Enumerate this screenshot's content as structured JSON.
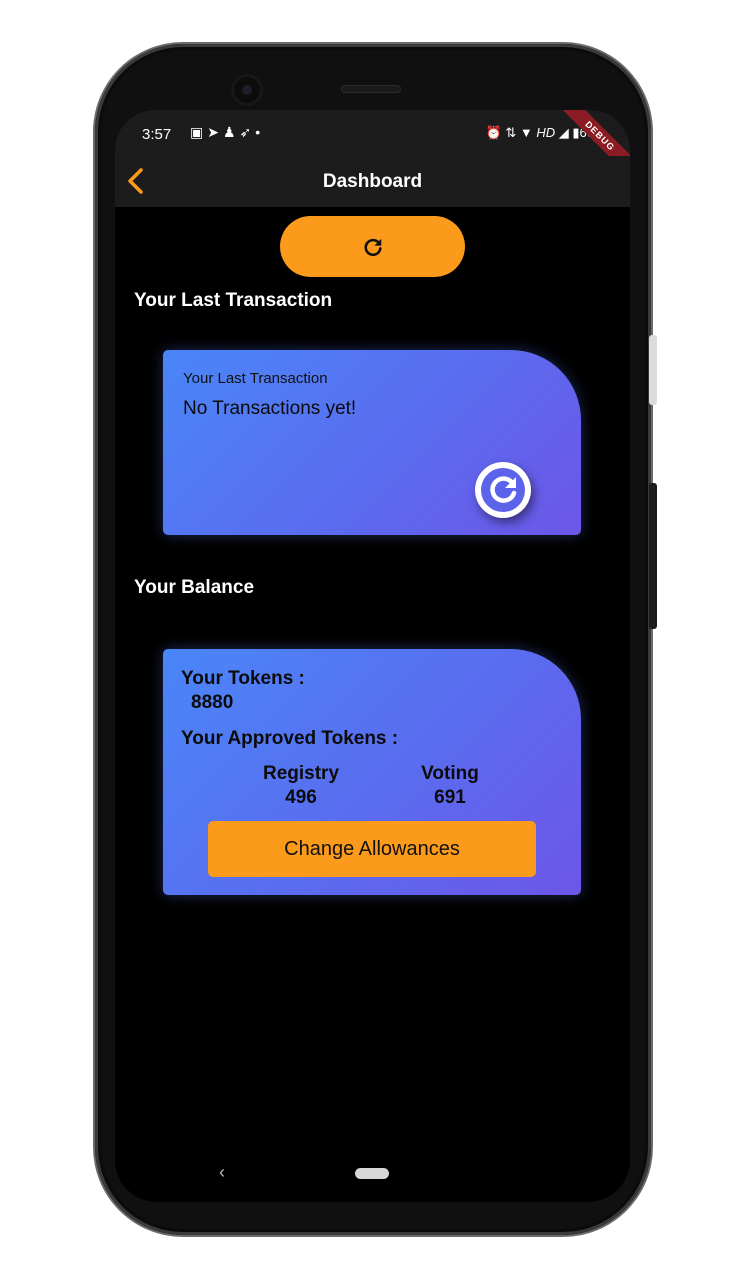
{
  "status_bar": {
    "time": "3:57",
    "left_icons": [
      "image-icon",
      "send-icon",
      "snapchat-icon",
      "navigation-icon",
      "dot-icon"
    ],
    "right_icons": [
      "alarm-icon",
      "data-icon",
      "wifi-icon",
      "signal-icon",
      "battery-icon"
    ],
    "hd_label": "HD",
    "battery_percent": "66",
    "debug_ribbon": "DEBUG"
  },
  "app_bar": {
    "title": "Dashboard",
    "back_icon": "chevron-left-icon"
  },
  "colors": {
    "accent": "#fb9a1b",
    "background": "#000000",
    "card_gradient_start": "#4a86f8",
    "card_gradient_end": "#6d56e8",
    "appbar": "#1c1c1c"
  },
  "last_transaction": {
    "section_title": "Your Last Transaction",
    "card_label": "Your Last Transaction",
    "card_value": "No Transactions yet!"
  },
  "balance": {
    "section_title": "Your Balance",
    "tokens_label": "Your Tokens :",
    "tokens_value": "8880",
    "approved_label": "Your Approved Tokens :",
    "registry_label": "Registry",
    "registry_value": "496",
    "voting_label": "Voting",
    "voting_value": "691",
    "change_button": "Change Allowances"
  },
  "nav_bar": {
    "back_symbol": "‹"
  }
}
